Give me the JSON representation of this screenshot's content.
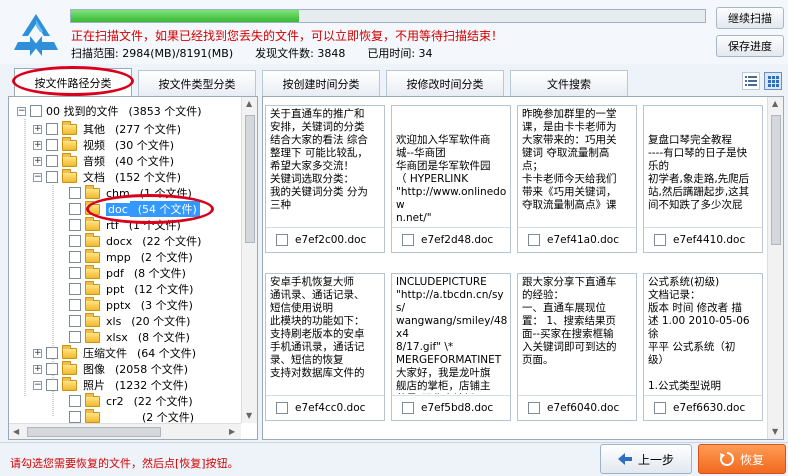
{
  "header": {
    "progress_fraction": 0.36,
    "scan_message": "正在扫描文件，如果已经找到您丢失的文件，可以立即恢复，不用等待扫描结束！",
    "scan_range": "扫描范围: 2984(MB)/8191(MB)",
    "found_files": "发现文件数: 3848",
    "elapsed": "已用时间: 34",
    "continue_scan_label": "继续扫描",
    "save_progress_label": "保存进度"
  },
  "tabs": [
    {
      "label": "按文件路径分类"
    },
    {
      "label": "按文件类型分类"
    },
    {
      "label": "按创建时间分类"
    },
    {
      "label": "按修改时间分类"
    },
    {
      "label": "文件搜索"
    }
  ],
  "tree": {
    "items": [
      {
        "name": "00 找到的文件",
        "count": "(3853 个文件)"
      },
      {
        "name": "其他",
        "count": "(277 个文件)"
      },
      {
        "name": "视频",
        "count": "(30 个文件)"
      },
      {
        "name": "音频",
        "count": "(40 个文件)"
      },
      {
        "name": "文档",
        "count": "(152 个文件)"
      },
      {
        "name": "chm",
        "count": "(1 个文件)"
      },
      {
        "name": "doc",
        "count": "(54 个文件)"
      },
      {
        "name": "rtf",
        "count": "(1 个文件)"
      },
      {
        "name": "docx",
        "count": "(22 个文件)"
      },
      {
        "name": "mpp",
        "count": "(2 个文件)"
      },
      {
        "name": "pdf",
        "count": "(8 个文件)"
      },
      {
        "name": "ppt",
        "count": "(12 个文件)"
      },
      {
        "name": "pptx",
        "count": "(3 个文件)"
      },
      {
        "name": "xls",
        "count": "(20 个文件)"
      },
      {
        "name": "xlsx",
        "count": "(8 个文件)"
      },
      {
        "name": "压缩文件",
        "count": "(64 个文件)"
      },
      {
        "name": "图像",
        "count": "(2058 个文件)"
      },
      {
        "name": "照片",
        "count": "(1232 个文件)"
      },
      {
        "name": "cr2",
        "count": "(22 个文件)"
      },
      {
        "name": "",
        "count": "(2 个文件)"
      }
    ]
  },
  "files": [
    {
      "name": "e7ef2c00.doc",
      "preview": "关于直通车的推广和\n安排，关键词的分类\n结合大家的看法 综合\n整理下 可能比较乱，\n希望大家多交流！\n关键词选取分类：\n我的关键词分类 分为\n三种"
    },
    {
      "name": "e7ef2d48.doc",
      "preview": "\n\n欢迎加入华军软件商\n城--华商团\n华商团是华军软件园\n（  HYPERLINK\n\"http://www.onlinedow\nn.net/\"\nhttp://www.onlinedown"
    },
    {
      "name": "e7ef41a0.doc",
      "preview": "昨晚参加群里的一堂\n课，是由卡卡老师为\n大家带来的：巧用关\n键词 夺取流量制高\n点；\n卡卡老师今天给我们\n带来《巧用关键词，\n夺取流量制高点》课"
    },
    {
      "name": "e7ef4410.doc",
      "preview": "\n\n复盘口琴完全教程\n----有口琴的日子是快\n乐的\n初学者,象走路,先爬后\n站,然后蹒跚起步,这其\n间不知跌了多少次屁"
    },
    {
      "name": "e7ef4cc0.doc",
      "preview": "安卓手机恢复大师\n通讯录、通话记录、\n短信使用说明\n此模块的功能如下：\n支持刷老版本的安卓\n手机通讯录，通话记\n录、短信的恢复\n支持对数据库文件的"
    },
    {
      "name": "e7ef5bd8.doc",
      "preview": "  INCLUDEPICTURE\n\"http://a.tbcdn.cn/sys/\nwangwang/smiley/48x4\n8/17.gif\" \\*\nMERGEFORMATINET\n大家好，我是龙叶旗\n舰店的掌柜，店铺主\n营是\"强化木地板\""
    },
    {
      "name": "e7ef6040.doc",
      "preview": "跟大家分享下直通车\n的经验：\n一、直通车展现位\n置：  1、搜索结果页\n面--买家在搜索框输\n入关键词即可到达的\n页面。"
    },
    {
      "name": "e7ef6630.doc",
      "preview": "公式系统(初级)\n文档记录：\n版本 时间 修改者 描\n述  1.00 2010-05-06 徐\n平平 公式系统（初\n级）\n\n1.公式类型说明"
    }
  ],
  "footer": {
    "hint": "请勾选您需要恢复的文件，然后点[恢复]按钮。",
    "prev_label": "上一步",
    "recover_label": "恢复"
  },
  "icons": {
    "logo": "recycle-arrows-icon",
    "prev": "arrow-left-icon",
    "recover": "recover-icon",
    "list_view": "list-view-icon",
    "grid_view": "grid-view-icon"
  },
  "colors": {
    "accent_red": "#d40000",
    "selection_blue": "#3399ff",
    "recover_orange": "#f2691e",
    "progress_green": "#38b833",
    "logo_blue": "#2f8fd8"
  }
}
